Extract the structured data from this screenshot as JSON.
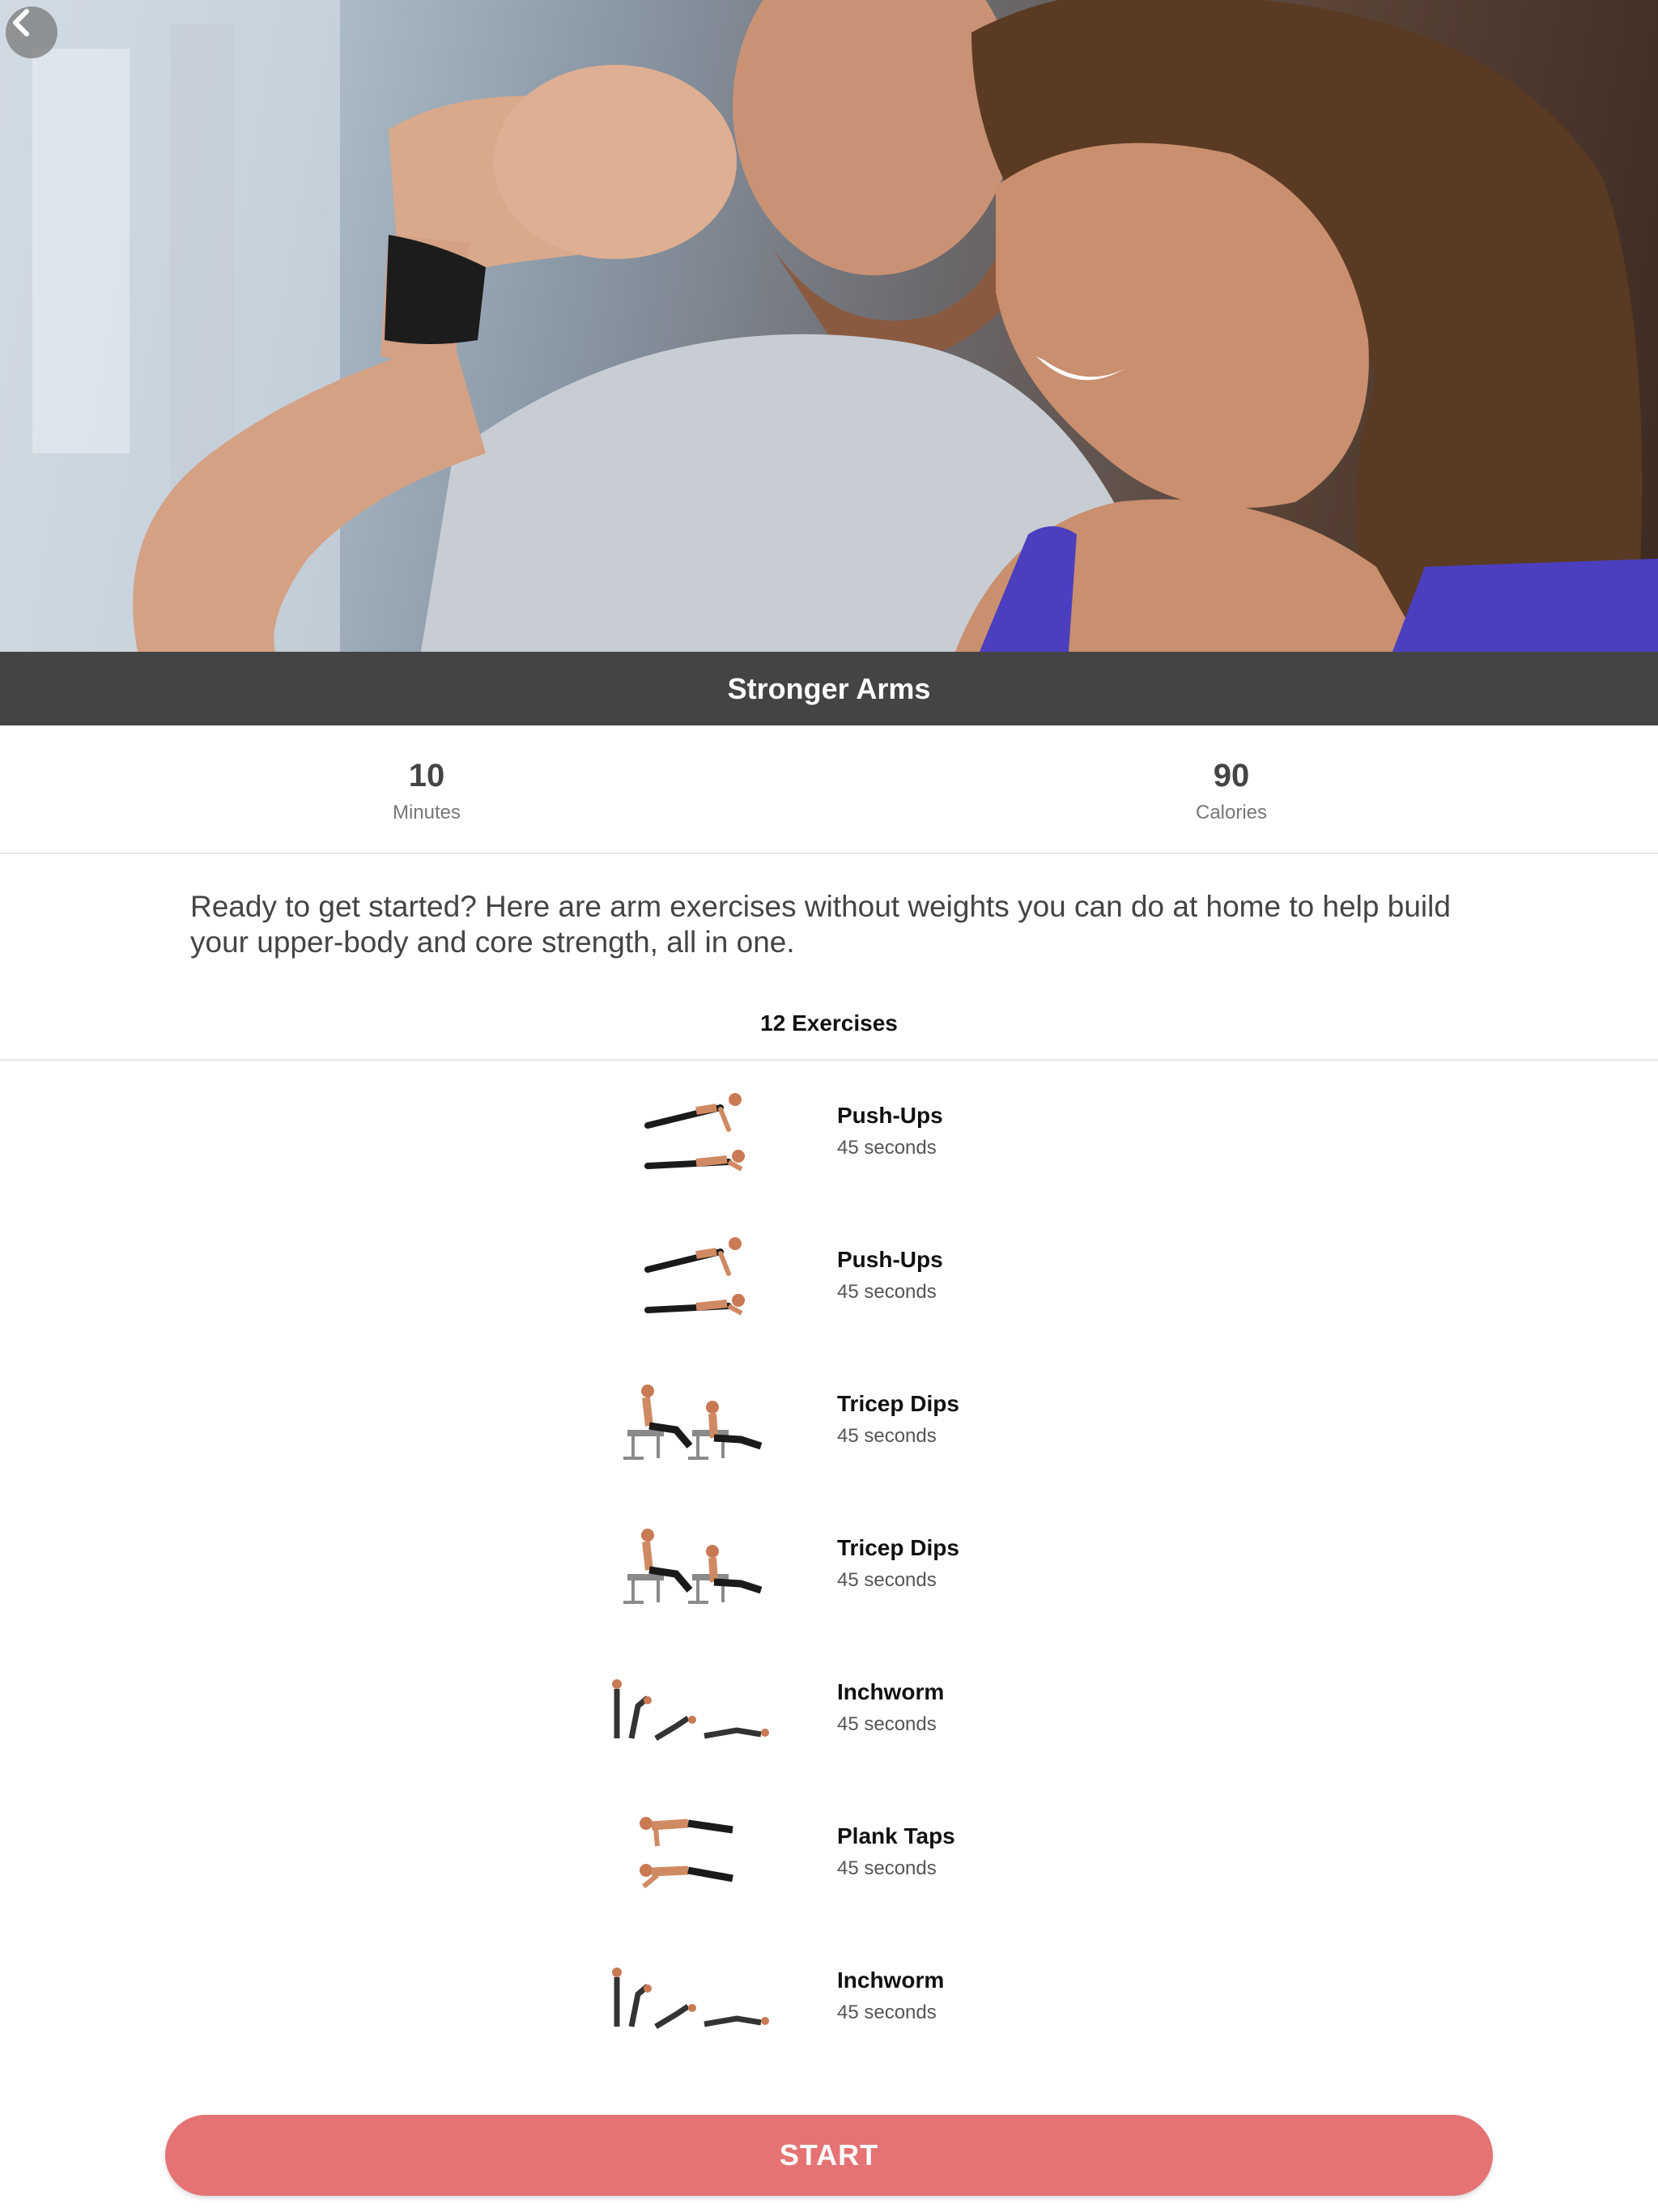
{
  "header": {
    "back_icon": "chevron-left-icon",
    "hero_image": "two-people-flexing-arm-gym-photo"
  },
  "workout": {
    "title": "Stronger Arms",
    "stats": [
      {
        "value": "10",
        "label": "Minutes"
      },
      {
        "value": "90",
        "label": "Calories"
      }
    ],
    "description": "Ready to get started? Here are arm exercises without weights you can do at home to help build your upper-body and core strength, all in one.",
    "exercise_count_label": "12 Exercises"
  },
  "exercises": [
    {
      "name": "Push-Ups",
      "duration": "45 seconds",
      "illustration": "push-ups"
    },
    {
      "name": "Push-Ups",
      "duration": "45 seconds",
      "illustration": "push-ups"
    },
    {
      "name": "Tricep Dips",
      "duration": "45 seconds",
      "illustration": "tricep-dips"
    },
    {
      "name": "Tricep Dips",
      "duration": "45 seconds",
      "illustration": "tricep-dips"
    },
    {
      "name": "Inchworm",
      "duration": "45 seconds",
      "illustration": "inchworm"
    },
    {
      "name": "Plank Taps",
      "duration": "45 seconds",
      "illustration": "plank-taps"
    },
    {
      "name": "Inchworm",
      "duration": "45 seconds",
      "illustration": "inchworm"
    }
  ],
  "actions": {
    "start_label": "START"
  },
  "colors": {
    "title_bar": "#444444",
    "start_button": "#e57373",
    "accent_blue": "#4b3fbf"
  }
}
